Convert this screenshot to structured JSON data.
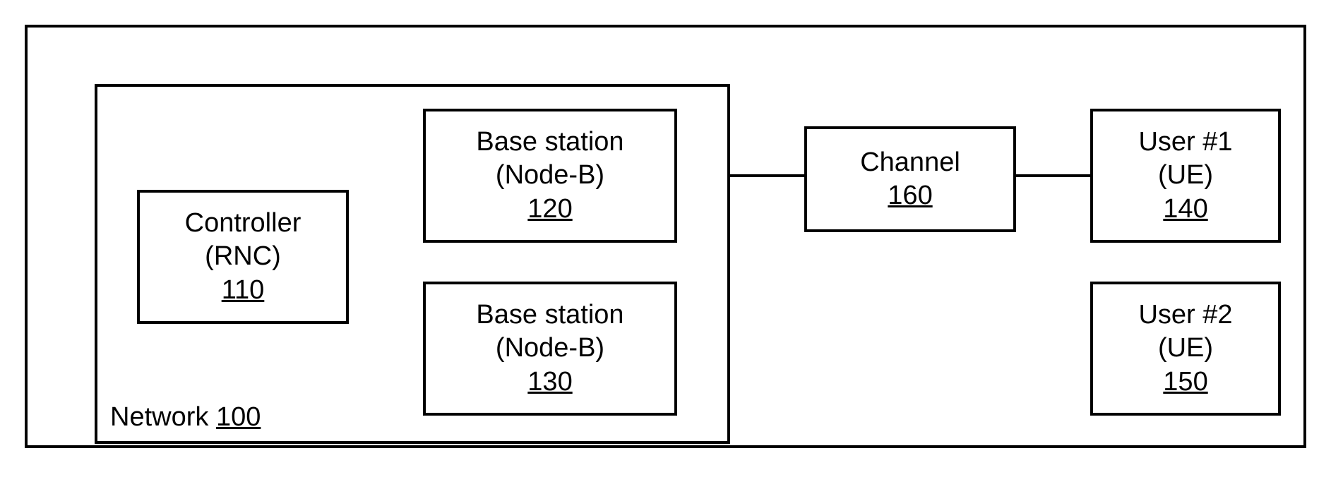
{
  "network": {
    "label_prefix": "Network",
    "ref": "100"
  },
  "controller": {
    "title": "Controller",
    "subtitle": "(RNC)",
    "ref": "110"
  },
  "bs1": {
    "title": "Base station",
    "subtitle": "(Node-B)",
    "ref": "120"
  },
  "bs2": {
    "title": "Base station",
    "subtitle": "(Node-B)",
    "ref": "130"
  },
  "channel": {
    "title": "Channel",
    "ref": "160"
  },
  "user1": {
    "title": "User #1",
    "subtitle": "(UE)",
    "ref": "140"
  },
  "user2": {
    "title": "User #2",
    "subtitle": "(UE)",
    "ref": "150"
  }
}
